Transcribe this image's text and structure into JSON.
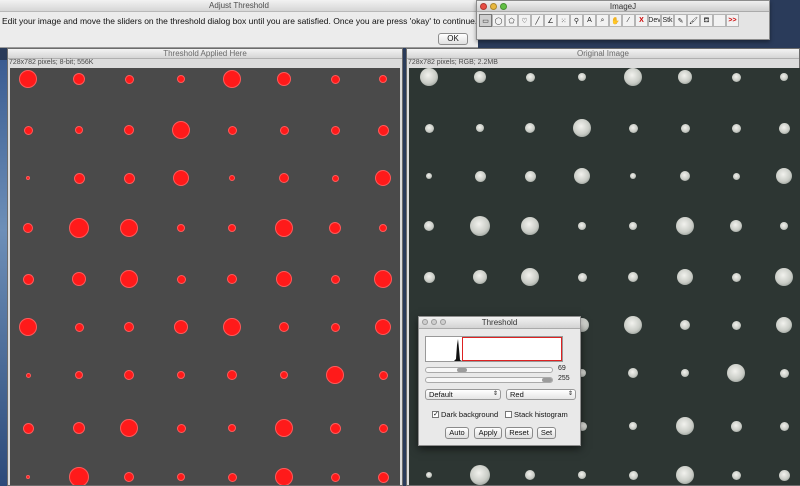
{
  "adjust_dialog": {
    "title": "Adjust Threshold",
    "message": "Edit your image and move the sliders on the threshold dialog box until you are satisfied.  Once you are press 'okay' to continue.",
    "ok_label": "OK"
  },
  "imagej": {
    "title": "ImageJ",
    "tools": [
      "rectangle-icon",
      "oval-icon",
      "polygon-icon",
      "freehand-icon",
      "line-icon",
      "angle-icon",
      "point-icon",
      "wand-icon",
      "text-icon",
      "magnifier-icon",
      "hand-icon",
      "dropper-icon",
      "X",
      "Dev",
      "Stk",
      "pencil-icon",
      "brush-icon",
      "flood-fill-icon",
      "",
      ">>"
    ]
  },
  "left_window": {
    "title": "Threshold Applied Here",
    "info": "728x782 pixels; 8-bit; 556K"
  },
  "right_window": {
    "title": "Original Image",
    "info": "728x782 pixels; RGB; 2.2MB"
  },
  "threshold_dialog": {
    "title": "Threshold",
    "min_value": "69",
    "max_value": "255",
    "min_fraction": 0.27,
    "max_fraction": 1.0,
    "method": "Default",
    "display": "Red",
    "dark_background_label": "Dark background",
    "dark_background": true,
    "stack_histogram_label": "Stack histogram",
    "stack_histogram": false,
    "buttons": {
      "auto": "Auto",
      "apply": "Apply",
      "reset": "Reset",
      "set": "Set"
    }
  },
  "colors": {
    "threshold_red": "#ff1a1a",
    "left_bg": "#4a4a4a",
    "right_bg": "#2d3633"
  }
}
